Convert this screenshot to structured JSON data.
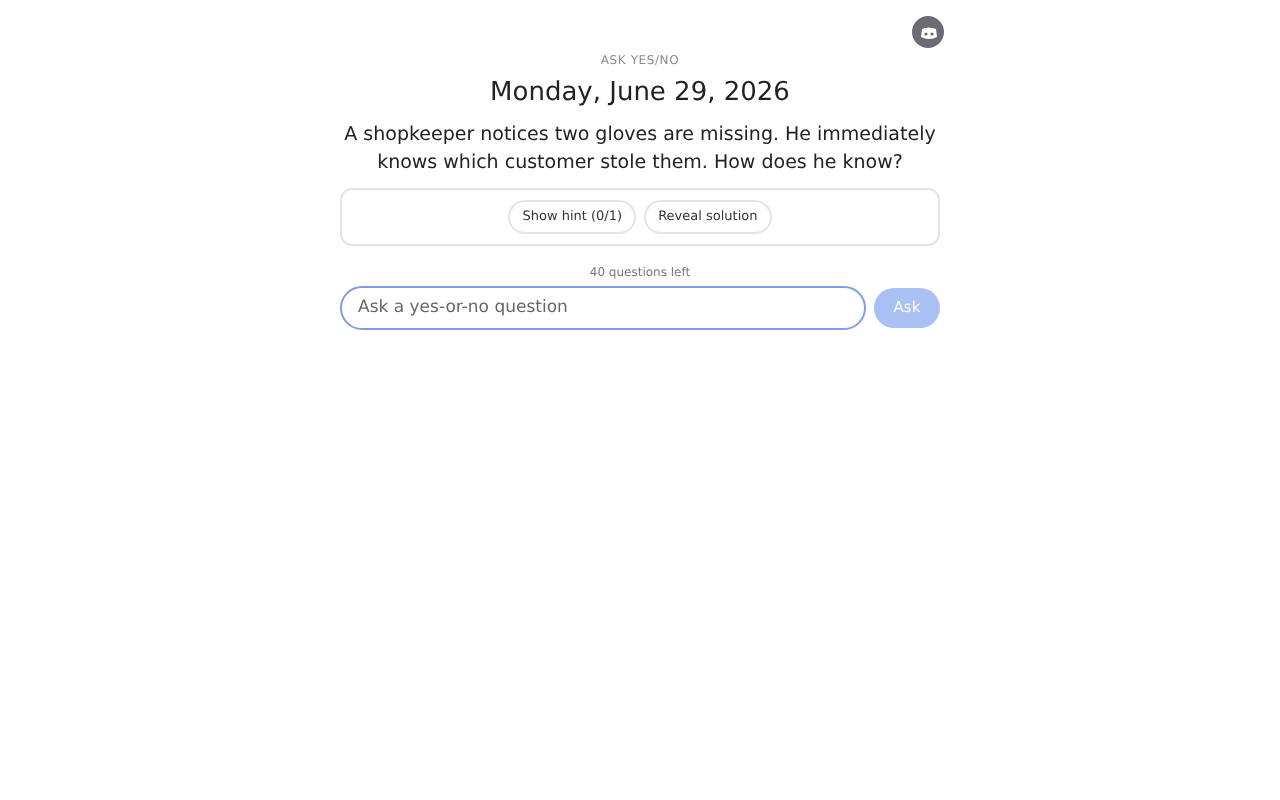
{
  "header": {
    "eyebrow": "ASK YES/NO",
    "date": "Monday, June 29, 2026"
  },
  "puzzle": "A shopkeeper notices two gloves are missing. He immediately knows which customer stole them. How does he know?",
  "actions": [
    "Show hint (0/1)",
    "Reveal solution"
  ],
  "questions_left": "40 questions left",
  "question_field": {
    "placeholder": "Ask a yes-or-no question"
  },
  "ask_button": {
    "label": "Ask",
    "disabled": true
  }
}
